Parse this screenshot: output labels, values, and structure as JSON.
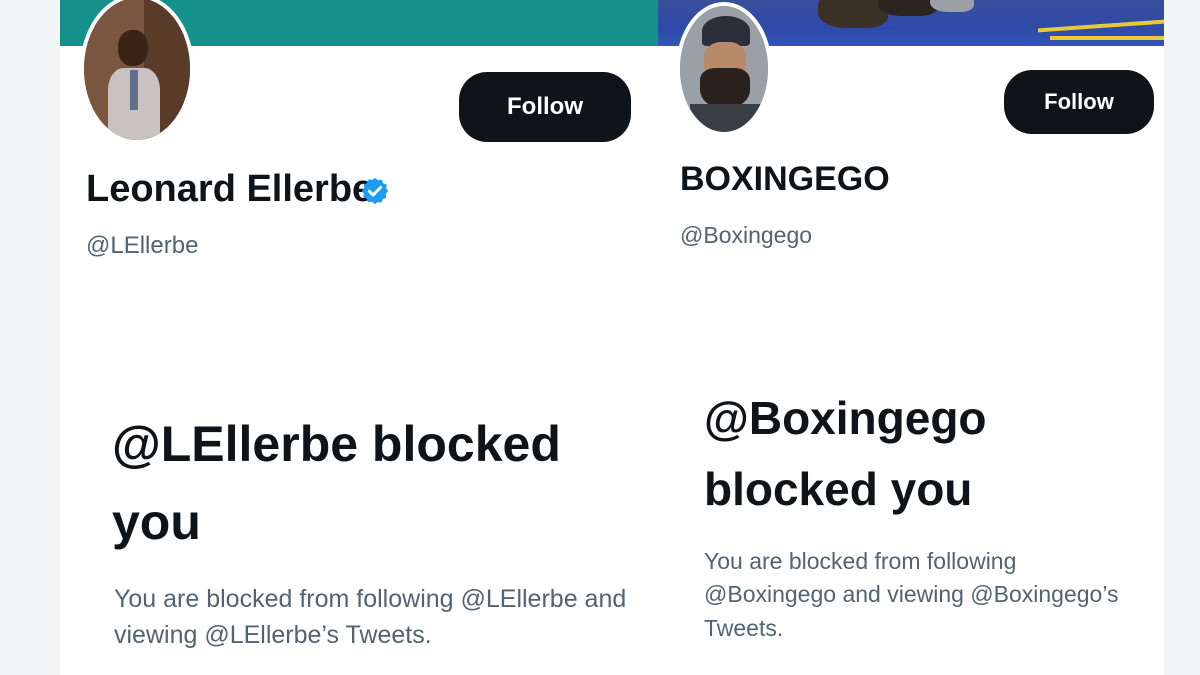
{
  "left_profile": {
    "display_name": "Leonard Ellerbe",
    "verified_badge": "verified-check",
    "handle": "@LEllerbe",
    "follow_label": "Follow",
    "banner_color": "#14918b",
    "blocked_title": "@LEllerbe blocked you",
    "blocked_description": "You are blocked from following @LEllerbe and viewing @LEllerbe’s Tweets."
  },
  "right_profile": {
    "display_name": "BOXINGEGO",
    "handle": "@Boxingego",
    "follow_label": "Follow",
    "blocked_title": "@Boxingego blocked you",
    "blocked_description": "You are blocked from following @Boxingego and viewing @Boxingego’s Tweets."
  },
  "colors": {
    "follow_button_bg": "#0f1419",
    "verified_blue": "#1d9bf0",
    "secondary_text": "#536471"
  }
}
